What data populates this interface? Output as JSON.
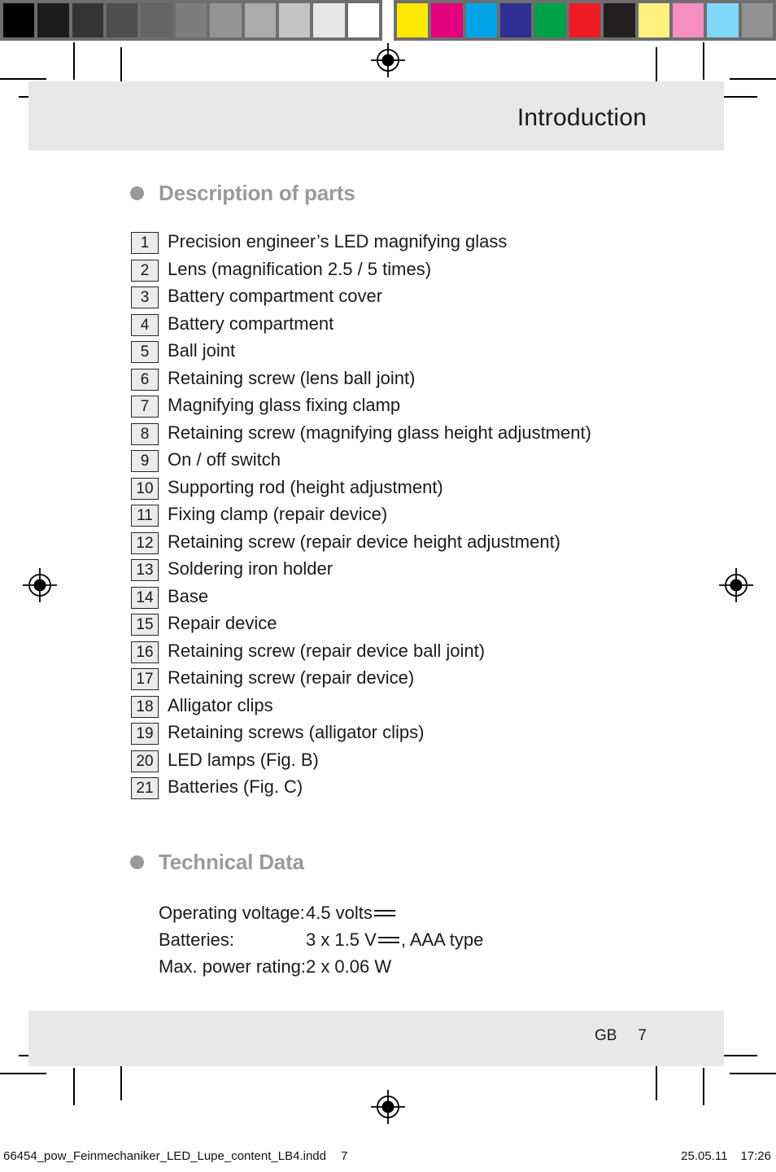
{
  "calibration": {
    "grayscale_swatches": [
      "#000000",
      "#1c1c1c",
      "#343434",
      "#4e4e4e",
      "#656565",
      "#7d7d7d",
      "#949494",
      "#ababab",
      "#c4c4c4",
      "#e6e6e6",
      "#ffffff"
    ],
    "color_swatches": [
      "#ffe900",
      "#e5007e",
      "#00a3e8",
      "#2e3192",
      "#00a14b",
      "#ed1c24",
      "#231f20",
      "#fdf07f",
      "#f58fc2",
      "#80d7f7",
      "#929292"
    ],
    "bar_background": "#6e6e6e"
  },
  "header": {
    "title": "Introduction",
    "band_color": "#e8e8e8"
  },
  "sections": {
    "description": {
      "heading": "Description of parts",
      "heading_color": "#9a9a9a",
      "bullet_icon": "filled-circle-bullet",
      "items": [
        {
          "num": "1",
          "label": "Precision engineer’s LED magnifying glass"
        },
        {
          "num": "2",
          "label": "Lens (magnification 2.5 / 5 times)"
        },
        {
          "num": "3",
          "label": "Battery compartment cover"
        },
        {
          "num": "4",
          "label": "Battery compartment"
        },
        {
          "num": "5",
          "label": "Ball joint"
        },
        {
          "num": "6",
          "label": "Retaining screw (lens ball joint)"
        },
        {
          "num": "7",
          "label": "Magnifying glass fixing clamp"
        },
        {
          "num": "8",
          "label": "Retaining screw (magnifying glass height adjustment)"
        },
        {
          "num": "9",
          "label": "On / off switch"
        },
        {
          "num": "10",
          "label": "Supporting rod (height adjustment)"
        },
        {
          "num": "11",
          "label": "Fixing clamp (repair device)"
        },
        {
          "num": "12",
          "label": "Retaining screw (repair device height adjustment)"
        },
        {
          "num": "13",
          "label": "Soldering iron holder"
        },
        {
          "num": "14",
          "label": "Base"
        },
        {
          "num": "15",
          "label": "Repair device"
        },
        {
          "num": "16",
          "label": "Retaining screw (repair device ball joint)"
        },
        {
          "num": "17",
          "label": "Retaining screw (repair device)"
        },
        {
          "num": "18",
          "label": "Alligator clips"
        },
        {
          "num": "19",
          "label": "Retaining screws (alligator clips)"
        },
        {
          "num": "20",
          "label": "LED lamps (Fig. B)"
        },
        {
          "num": "21",
          "label": "Batteries (Fig. C)"
        }
      ]
    },
    "technical_data": {
      "heading": "Technical Data",
      "bullet_icon": "filled-circle-bullet",
      "rows": [
        {
          "label": "Operating voltage:",
          "value_before": "4.5 volts",
          "dc_symbol": true,
          "value_after": ""
        },
        {
          "label": "Batteries:",
          "value_before": "3 x 1.5 V",
          "dc_symbol": true,
          "value_after": ", AAA type"
        },
        {
          "label": "Max. power rating:",
          "value_before": "2 x 0.06 W",
          "dc_symbol": false,
          "value_after": ""
        }
      ]
    }
  },
  "footer": {
    "locale": "GB",
    "page_number": "7",
    "band_color": "#e8e8e8"
  },
  "slug": {
    "filename": "66454_pow_Feinmechaniker_LED_Lupe_content_LB4.indd",
    "sheet_number": "7",
    "date": "25.05.11",
    "time": "17:26"
  }
}
